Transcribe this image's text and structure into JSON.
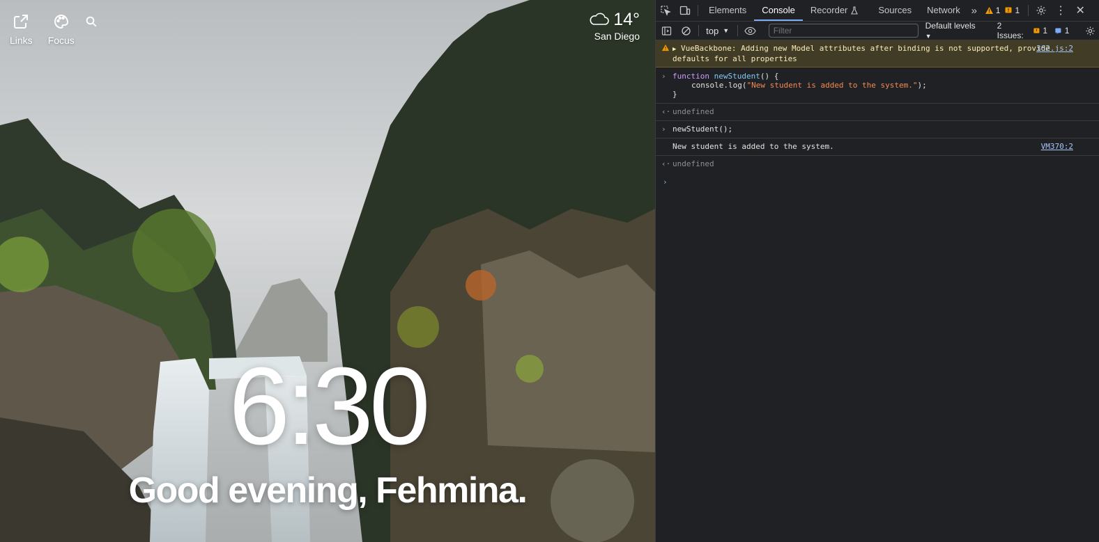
{
  "newtab": {
    "links_label": "Links",
    "focus_label": "Focus",
    "weather": {
      "temp": "14°",
      "city": "San Diego"
    },
    "clock": "6:30",
    "greeting": "Good evening, Fehmina."
  },
  "devtools": {
    "tabs": [
      "Elements",
      "Console",
      "Recorder",
      "Sources",
      "Network"
    ],
    "active_tab": "Console",
    "warn_count": "1",
    "error_count": "1",
    "context": "top",
    "filter_placeholder": "Filter",
    "levels": "Default levels",
    "issues_label": "2 Issues:",
    "issues_warn": "1",
    "issues_info": "1",
    "messages": {
      "warning": "VueBackbone: Adding new Model attributes after binding is not supported, provide defaults for all properties",
      "warning_source": "362.js:2",
      "fn_kw": "function",
      "fn_name": "newStudent",
      "fn_open": "() {",
      "fn_body_pre": "console.log(",
      "fn_body_str": "\"New student is added to the system.\"",
      "fn_body_post": ");",
      "fn_close": "}",
      "undefined1": "undefined",
      "call": "newStudent();",
      "log": "New student is added to the system.",
      "log_source": "VM370:2",
      "undefined2": "undefined"
    },
    "colors": {
      "accent": "#7cacf8",
      "warning_bg": "#413c26",
      "panel_bg": "#202124"
    }
  }
}
